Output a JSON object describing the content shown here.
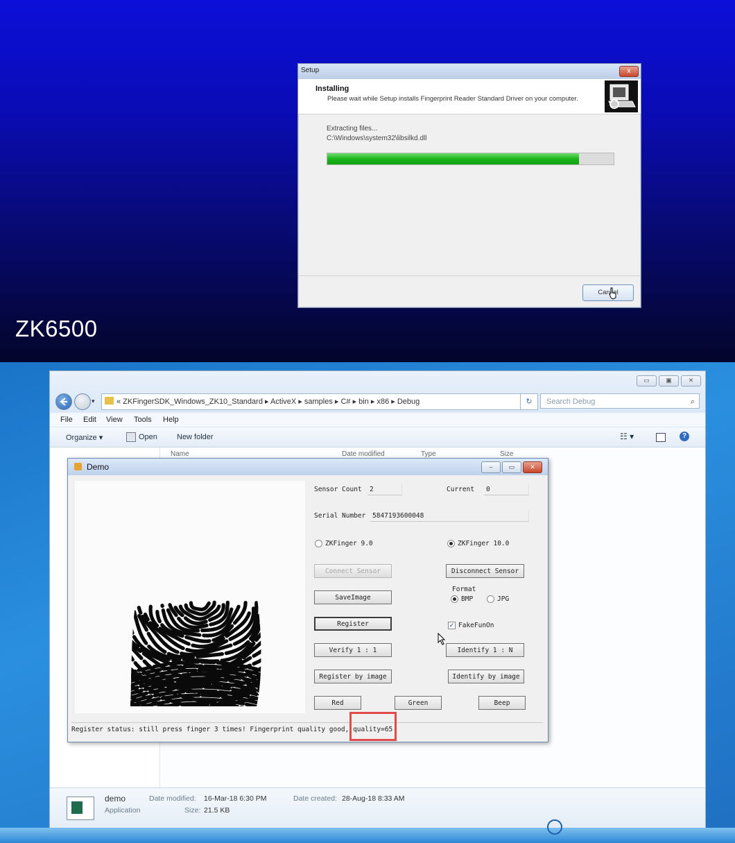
{
  "top_panel": {
    "caption": "ZK6500",
    "setup_dialog": {
      "title": "Setup",
      "close_glyph": "x",
      "header_title": "Installing",
      "header_desc": "Please wait while Setup installs Fingerprint Reader Standard Driver on your computer.",
      "status_line": "Extracting files...",
      "file_path": "C:\\Windows\\system32\\libsilkd.dll",
      "progress": 0.88,
      "cancel_label": "Cancel"
    }
  },
  "explorer": {
    "window_buttons": [
      "▭",
      "▣",
      "✕"
    ],
    "breadcrumb": "« ZKFingerSDK_Windows_ZK10_Standard ▸ ActiveX ▸ samples ▸ C# ▸ bin ▸ x86 ▸ Debug",
    "search_placeholder": "Search Debug",
    "menu": [
      "File",
      "Edit",
      "View",
      "Tools",
      "Help"
    ],
    "commands": {
      "organize": "Organize ▾",
      "open": "Open",
      "new_folder": "New folder"
    },
    "columns": [
      "Name",
      "Date modified",
      "Type",
      "Size"
    ],
    "details": {
      "name": "demo",
      "kind": "Application",
      "date_modified_label": "Date modified:",
      "date_modified": "16-Mar-18 6:30 PM",
      "size_label": "Size:",
      "size": "21.5 KB",
      "date_created_label": "Date created:",
      "date_created": "28-Aug-18 8:33 AM"
    }
  },
  "demo": {
    "title": "Demo",
    "sensor_count_label": "Sensor Count",
    "sensor_count": "2",
    "current_label": "Current",
    "current": "0",
    "serial_label": "Serial Number",
    "serial": "5847193600048",
    "zkfinger9": "ZKFinger 9.0",
    "zkfinger10": "ZKFinger 10.0",
    "selected_engine": "ZKFinger 10.0",
    "connect_sensor": "Connect Sensor",
    "disconnect_sensor": "Disconnect Sensor",
    "save_image": "SaveImage",
    "format_label": "Format",
    "bmp": "BMP",
    "jpg": "JPG",
    "selected_format": "BMP",
    "register": "Register",
    "fakefun": "FakeFunOn",
    "fakefun_checked": true,
    "verify": "Verify 1 : 1",
    "identify": "Identify 1 : N",
    "register_by_image": "Register by image",
    "identify_by_image": "Identify by image",
    "red": "Red",
    "green": "Green",
    "beep": "Beep",
    "status": "Register status: still press finger 3 times! Fingerprint quality good, quality=65"
  },
  "colors": {
    "progress_green": "#1bb51b",
    "highlight_red": "#e04a4a",
    "top_bg": "#0a0cb6",
    "desktop_blue": "#2b8fdf"
  }
}
